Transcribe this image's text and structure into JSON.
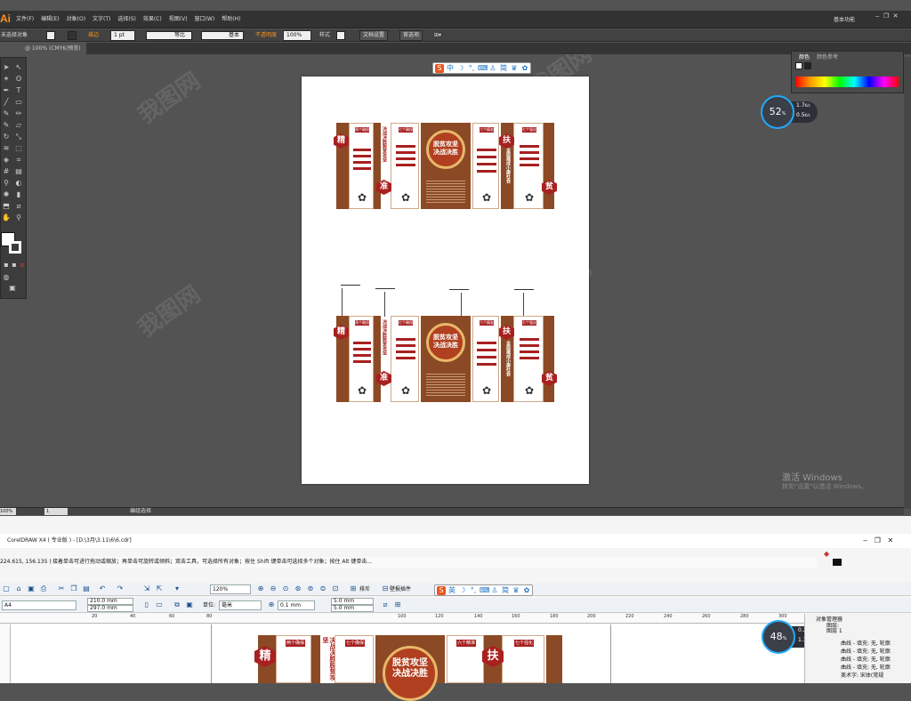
{
  "illustrator": {
    "menu": [
      "文件(F)",
      "编辑(E)",
      "对象(O)",
      "文字(T)",
      "选择(S)",
      "效果(C)",
      "视图(V)",
      "窗口(W)",
      "帮助(H)"
    ],
    "workspace": "基本功能",
    "control": {
      "selection": "未选择对象",
      "stroke_label": "描边",
      "stroke_value": "1 pt",
      "profile": "等比",
      "brush": "基本",
      "opacity_label": "不透明度",
      "opacity_value": "100%",
      "style_label": "样式",
      "doc_setup": "文档设置",
      "prefs": "首选项"
    },
    "doc_tab": "@ 100% (CMYK/预览)",
    "color_panel": {
      "tab1": "颜色",
      "tab2": "颜色参考"
    },
    "status": {
      "zoom": "100%",
      "page": "1",
      "tool": "编组选择"
    },
    "gauge": {
      "percent": "52",
      "unit": "%",
      "up": "1.7",
      "down": "0.5",
      "speed_unit": "K/s"
    }
  },
  "boards": [
    {
      "left_hex": "精",
      "mid_hex": "准",
      "right_top_hex": "扶",
      "right_hex": "贫",
      "center_title": "脱贫攻坚 决战决胜",
      "tags": [
        "两个确保",
        "七个确保",
        "六个精准",
        "七个强化"
      ],
      "vtitle1": "决战决胜脱贫攻坚",
      "vtitle2": "全面建成小康社会"
    }
  ],
  "windows_watermark": {
    "line1": "激活 Windows",
    "line2": "转到\"设置\"以激活 Windows。"
  },
  "coreldraw": {
    "title": "CorelDRAW X4 ( 专业版 ) - [D:\\3月\\3.11\\6\\6.cdr]",
    "coords": "224.615, 156.135 )",
    "hint": "接着单击可进行拖动或缩放；再单击可旋转或倾斜；双击工具，可选择所有对象；按住 Shift 键单击可选择多个对象；按住 Alt 键单击...",
    "paper": "A4",
    "width": "210.0 mm",
    "height": "297.0 mm",
    "units_label": "单位:",
    "units": "毫米",
    "nudge": "0.1 mm",
    "dup_x": "5.0 mm",
    "dup_y": "5.0 mm",
    "zoom": "120%",
    "snap": "排斥",
    "plugin": "壁报插件",
    "object_manager": {
      "title": "对象管理器",
      "layer": "图层:",
      "layer_name": "图层 1",
      "items": [
        "曲线 - 填充: 无, 轮廓",
        "曲线 - 填充: 无, 轮廓",
        "曲线 - 填充: 无, 轮廓",
        "曲线 - 填充: 无, 轮廓",
        "美术字: 宋体(常规"
      ]
    },
    "ruler_ticks": [
      "20",
      "40",
      "60",
      "80",
      "100",
      "120",
      "140",
      "160",
      "180",
      "200",
      "220",
      "240",
      "260",
      "280",
      "300"
    ],
    "gauge": {
      "percent": "48",
      "unit": "%",
      "up": "0.2",
      "down": "1.3",
      "speed_unit": "K/s"
    }
  },
  "float_toolbar": {
    "label": "中"
  },
  "cd_float_toolbar": {
    "label": "英"
  }
}
